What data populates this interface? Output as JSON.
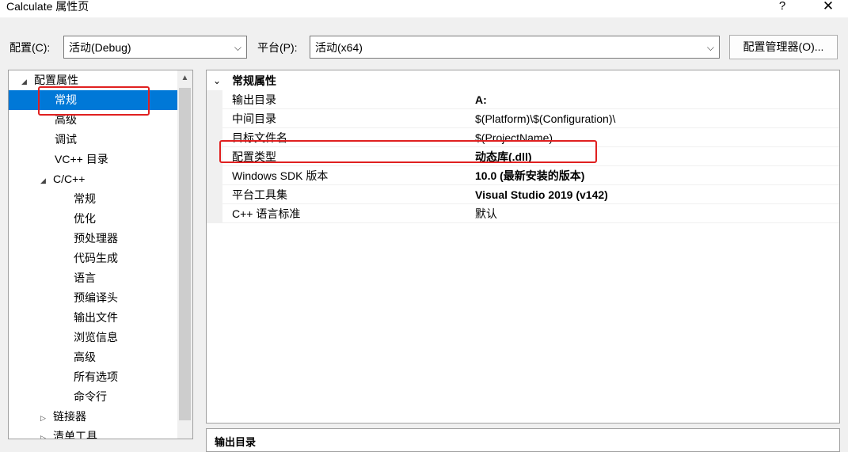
{
  "window": {
    "title": "Calculate 属性页",
    "help_label": "?",
    "close_label": "✕"
  },
  "toolbar": {
    "config_label": "配置(C):",
    "config_value": "活动(Debug)",
    "platform_label": "平台(P):",
    "platform_value": "活动(x64)",
    "config_manager_label": "配置管理器(O)..."
  },
  "tree": {
    "items": [
      {
        "label": "配置属性",
        "level": 0,
        "toggle": "◢"
      },
      {
        "label": "常规",
        "level": 1,
        "selected": true
      },
      {
        "label": "高级",
        "level": 1
      },
      {
        "label": "调试",
        "level": 1
      },
      {
        "label": "VC++ 目录",
        "level": 1
      },
      {
        "label": "C/C++",
        "level": 1,
        "toggle": "◢"
      },
      {
        "label": "常规",
        "level": 2
      },
      {
        "label": "优化",
        "level": 2
      },
      {
        "label": "预处理器",
        "level": 2
      },
      {
        "label": "代码生成",
        "level": 2
      },
      {
        "label": "语言",
        "level": 2
      },
      {
        "label": "预编译头",
        "level": 2
      },
      {
        "label": "输出文件",
        "level": 2
      },
      {
        "label": "浏览信息",
        "level": 2
      },
      {
        "label": "高级",
        "level": 2
      },
      {
        "label": "所有选项",
        "level": 2
      },
      {
        "label": "命令行",
        "level": 2
      },
      {
        "label": "链接器",
        "level": 1,
        "toggle": "▷"
      },
      {
        "label": "清单工具",
        "level": 1,
        "toggle": "▷"
      }
    ]
  },
  "props": {
    "section_label": "常规属性",
    "rows": [
      {
        "name": "输出目录",
        "value": "A:",
        "bold": true
      },
      {
        "name": "中间目录",
        "value": "$(Platform)\\$(Configuration)\\",
        "bold": false
      },
      {
        "name": "目标文件名",
        "value": "$(ProjectName)",
        "bold": false
      },
      {
        "name": "配置类型",
        "value": "动态库(.dll)",
        "bold": true
      },
      {
        "name": "Windows SDK 版本",
        "value": "10.0 (最新安装的版本)",
        "bold": true
      },
      {
        "name": "平台工具集",
        "value": "Visual Studio 2019 (v142)",
        "bold": true
      },
      {
        "name": "C++ 语言标准",
        "value": "默认",
        "bold": false
      }
    ]
  },
  "description": {
    "label": "输出目录"
  },
  "colors": {
    "selection": "#0078d7",
    "highlight_box": "#e02020"
  }
}
